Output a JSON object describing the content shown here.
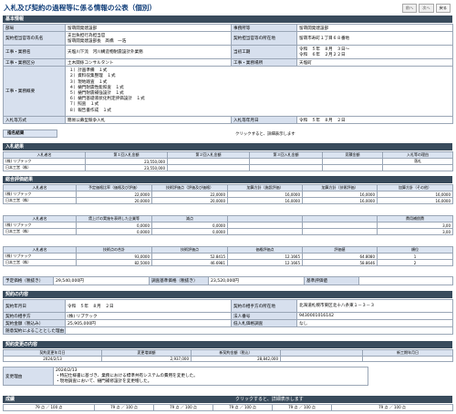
{
  "page": {
    "title": "入札及び契約の過程等に係る情報の公表（個別）"
  },
  "nav": [
    "前へ",
    "次へ",
    "戻る"
  ],
  "s1": {
    "title": "基本情報"
  },
  "basic": {
    "bumon_l": "部局",
    "bumon": "留萌開発建設部",
    "jimusho_l": "事務所等",
    "jimusho": "留萌開発建設部",
    "shozai_l": "契約担当官等の氏名",
    "shozai": "支出負担行為担当官\n留萌開発建設部長　髙橋　一浩",
    "shozai2_l": "契約担当官等の所在地",
    "shozai2": "留萌市寿町１丁目６８番地",
    "name_l": "工事・業務名",
    "name": "天塩川下流　河川構造物耐震設計外業務",
    "kubun_l": "当初工期",
    "kubun": "令和　５年　８月　３日～\n令和　６年　２月２２日",
    "gyoshu_l": "工事・業務区分",
    "gyoshu": "土木関係コンサルタント",
    "basho_l": "工事・業務場所",
    "basho": "天塩町",
    "gaiyo_l": "工事・業務概要",
    "gaiyo": [
      "１）計画準備　１式",
      "２）資料収集整理　１式",
      "３）現地踏査　１式",
      "４）樋門耐震性能照査　１式",
      "５）樋門耐震補強設計　１式",
      "６）樋門基礎液状化判定評価設計　１式",
      "７）照査　１式",
      "８）報告書作成　１式"
    ],
    "hoshiki_l": "入札等方式",
    "hoshiki": "簡易公募型競争入札",
    "date_l": "入札等年月日",
    "date": "令和　５年　８月　２日"
  },
  "s2": {
    "title": "指名結果",
    "note": "クリックすると、詳細表示します"
  },
  "s3": {
    "title": "入札結果"
  },
  "bid": {
    "headers": [
      "入札者名",
      "第１回入札金額",
      "第２回入札金額",
      "第３回入札金額",
      "見積金額",
      "入札等の理由"
    ],
    "rows": [
      [
        "(株) リプテック",
        "23,550,000",
        "",
        "",
        "",
        "落札"
      ],
      [
        "日本工営（株）",
        "23,550,000",
        "",
        "",
        "",
        ""
      ]
    ]
  },
  "s4": {
    "title": "総合評価結果"
  },
  "eval1": {
    "headers": [
      "入札者名",
      "予定価格比率（価格及び評価）",
      "技術評価点（評価及び価格）",
      "加算方針（施設評価）",
      "加算方針（技術評価）",
      "加算方針（その他）"
    ],
    "rows": [
      [
        "(株) リプテック",
        "22,0000",
        "22,0000",
        "16,0000",
        "16,0000",
        "16,0000"
      ],
      [
        "日本工営（株）",
        "20,0000",
        "20,0000",
        "16,0000",
        "16,0000",
        "16,0000"
      ]
    ]
  },
  "eval2": {
    "headers": [
      "入札者名",
      "賃上げの実施を表明した企業等",
      "減点",
      "",
      "",
      "費用補償費"
    ],
    "rows": [
      [
        "(株) リプテック",
        "0,0000",
        "0,0000",
        "",
        "",
        "3,00"
      ],
      [
        "日本工営（株）",
        "0,0000",
        "0,0000",
        "",
        "",
        "3,00"
      ]
    ]
  },
  "eval3": {
    "headers": [
      "入札者名",
      "技術点の合計",
      "技術評価点",
      "価格評価点",
      "評価値",
      "順位"
    ],
    "rows": [
      [
        "(株) リプテック",
        "93,0000",
        "52.8415",
        "12.1665",
        "64.8080",
        "1"
      ],
      [
        "日本工営（株）",
        "82,5000",
        "46.6981",
        "12.1665",
        "58.8646",
        "2"
      ]
    ]
  },
  "price": {
    "yotei_l": "予定価格（税抜き）",
    "yotei": "29,540,000円",
    "chosa_l": "調査基準価格（税抜き）",
    "chosa": "23,520,000円",
    "kijun_l": "基準評価値",
    "kijun": ""
  },
  "s5": {
    "title": "契約の内容"
  },
  "contract": {
    "date_l": "契約年月日",
    "date": "令和　５年　８月　２日",
    "addr_l": "契約の相手方の所在地",
    "addr": "北海道札幌市東区北十八条東１－３－３",
    "party_l": "契約の相手方",
    "party": "(株) リプテック",
    "houjin_l": "法人番号",
    "houjin": "9430001016142",
    "amount_l": "契約金額（税込み）",
    "amount": "25,905,000円",
    "low_l": "低入札価格調査",
    "low": "なし",
    "reason_l": "随意契約によることとした理由",
    "reason": ""
  },
  "s6": {
    "title": "契約変更の内容"
  },
  "change": {
    "headers": [
      "契約変更年月日",
      "変更増減額",
      "新契約金額（税込）",
      "",
      "新工期年月日"
    ],
    "row": [
      "2024/2/13",
      "2,937,000",
      "28,842,000",
      "",
      ""
    ],
    "reason_l": "変更理由",
    "reason": [
      "2024/2/13",
      "・特記仕様書に基づき、業務における標準共有システムの費用を変更した。",
      "・現地調査において、樋門補修設計を変更増した。"
    ]
  },
  "s7": {
    "title": "成績",
    "note": "クリックすると、詳細表示します"
  },
  "grade": {
    "headers": [
      "",
      "",
      "",
      "",
      "",
      ""
    ],
    "row": [
      "79 点 ／ 100 点",
      "79 点 ／ 100 点",
      "79 点 ／ 100 点",
      "79 点 ／ 100 点",
      "79 点 ／ 100 点",
      "79 点 ／ 100 点"
    ]
  }
}
